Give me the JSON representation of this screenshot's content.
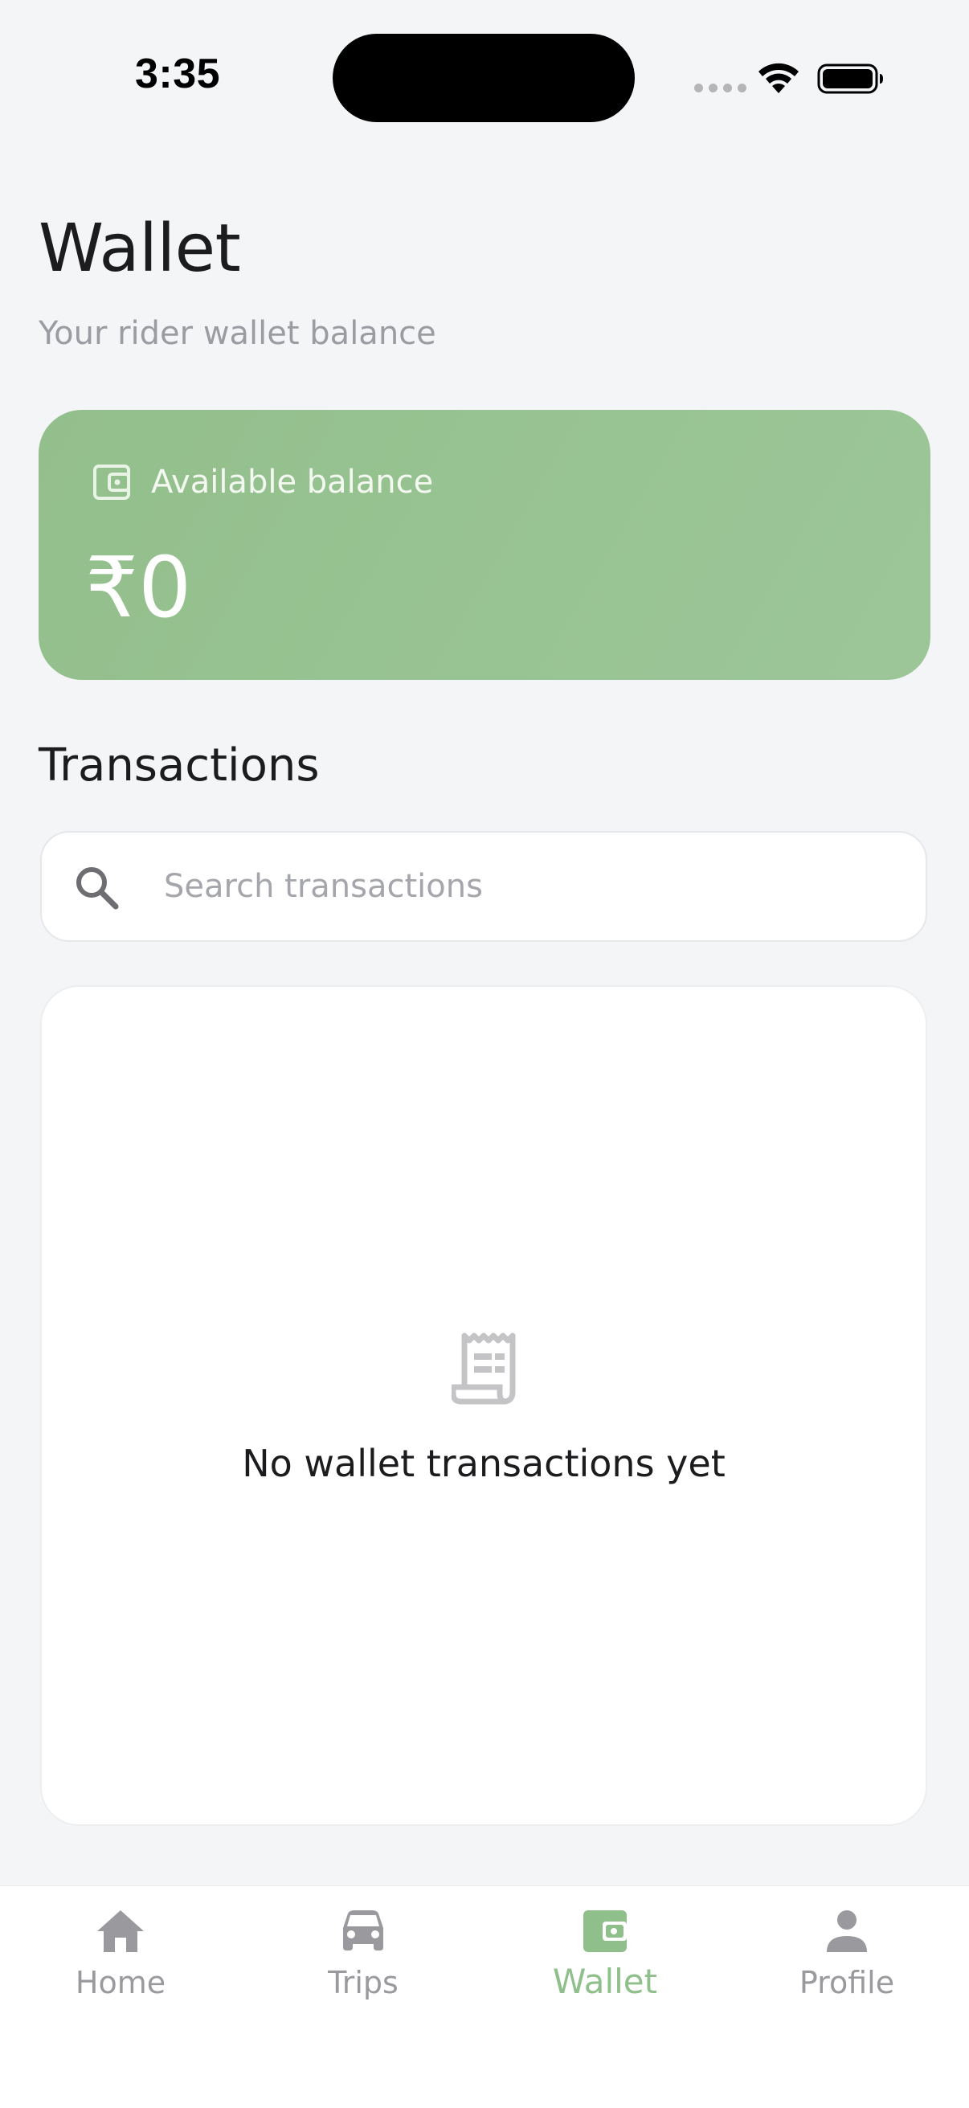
{
  "status_bar": {
    "time": "3:35"
  },
  "header": {
    "title": "Wallet",
    "subtitle": "Your rider wallet balance"
  },
  "balance_card": {
    "label": "Available balance",
    "amount": "₹0",
    "icon": "wallet-icon",
    "color": "#97c292"
  },
  "transactions": {
    "title": "Transactions",
    "search_placeholder": "Search transactions",
    "search_value": "",
    "empty_icon": "receipt-icon",
    "empty_text": "No wallet transactions yet"
  },
  "bottom_nav": {
    "items": [
      {
        "label": "Home",
        "icon": "home-icon",
        "active": false
      },
      {
        "label": "Trips",
        "icon": "car-icon",
        "active": false
      },
      {
        "label": "Wallet",
        "icon": "wallet-icon",
        "active": true
      },
      {
        "label": "Profile",
        "icon": "person-icon",
        "active": false
      }
    ],
    "active_color": "#8fbf8a",
    "inactive_color": "#9a9a9e"
  }
}
